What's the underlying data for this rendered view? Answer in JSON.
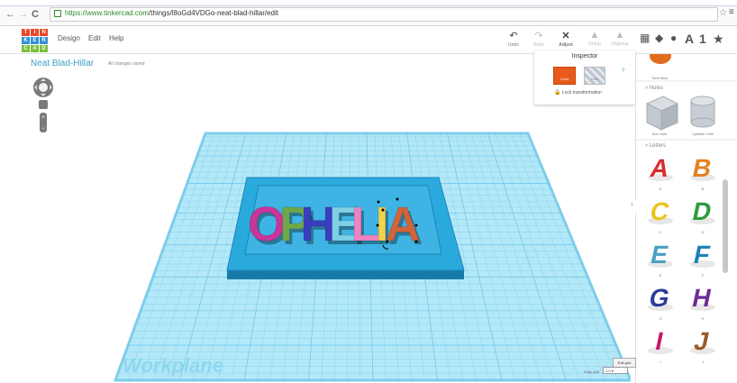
{
  "browser": {
    "back": "←",
    "forward": "→",
    "reload": "C",
    "url_host": "https://www.tinkercad.com",
    "url_path": "/things/l8oGd4VDGo-neat-blad-hillar/edit",
    "star": "☆",
    "menu": "≡"
  },
  "logo": {
    "letters": [
      "T",
      "I",
      "N",
      "K",
      "E",
      "R",
      "C",
      "A",
      "D"
    ],
    "colors": [
      "#e8482b",
      "#e8482b",
      "#e8482b",
      "#2f8fd8",
      "#2f8fd8",
      "#2f8fd8",
      "#7bbf3a",
      "#7bbf3a",
      "#7bbf3a"
    ]
  },
  "menu": {
    "items": [
      "Design",
      "Edit",
      "Help"
    ]
  },
  "toolbar": {
    "undo": "Undo",
    "redo": "Redo",
    "adjust": "Adjust",
    "group": "Group",
    "ungroup": "Ungroup"
  },
  "right_tools": {
    "letter_a": "A",
    "number_one": "1",
    "star": "★"
  },
  "design": {
    "title": "Neat Blad-Hillar",
    "save_status": "All changes saved"
  },
  "scene": {
    "text": [
      "O",
      "P",
      "H",
      "E",
      "L",
      "I",
      "A"
    ],
    "letter_colors": [
      "#c9359a",
      "#6fa84a",
      "#3a3dbf",
      "#7fd0e6",
      "#ef82c0",
      "#f2d24a",
      "#d2643a"
    ],
    "workplane_label": "Workplane"
  },
  "inspector": {
    "title": "Inspector",
    "color_label": "Color",
    "hole_label": "Hole",
    "help": "?",
    "lock_label": "Lock transformation"
  },
  "panel": {
    "top_item": "Tube thick",
    "holes_section": "Holes",
    "box_hole": "Box Hole",
    "cylinder_hole": "Cylinder Hole",
    "letters_section": "Letters",
    "letters": [
      {
        "label": "A",
        "color": "#d82d2d"
      },
      {
        "label": "B",
        "color": "#e68023"
      },
      {
        "label": "C",
        "color": "#e8c51a"
      },
      {
        "label": "D",
        "color": "#2f9a3a"
      },
      {
        "label": "E",
        "color": "#4aa0c0"
      },
      {
        "label": "F",
        "color": "#1f7fb8"
      },
      {
        "label": "G",
        "color": "#2a3b9a"
      },
      {
        "label": "H",
        "color": "#6b2d96"
      },
      {
        "label": "I",
        "color": "#c2186b"
      },
      {
        "label": "J",
        "color": "#9a5a2a"
      }
    ]
  },
  "grid": {
    "edit_grid": "Edit grid",
    "snap_label": "Snap grid",
    "snap_value": "1.0"
  },
  "colors": {
    "accent": "#39a0c9",
    "workplane": "#a8e3f7",
    "grid_line": "#6cc4e8",
    "base": "#2aa9dd"
  }
}
